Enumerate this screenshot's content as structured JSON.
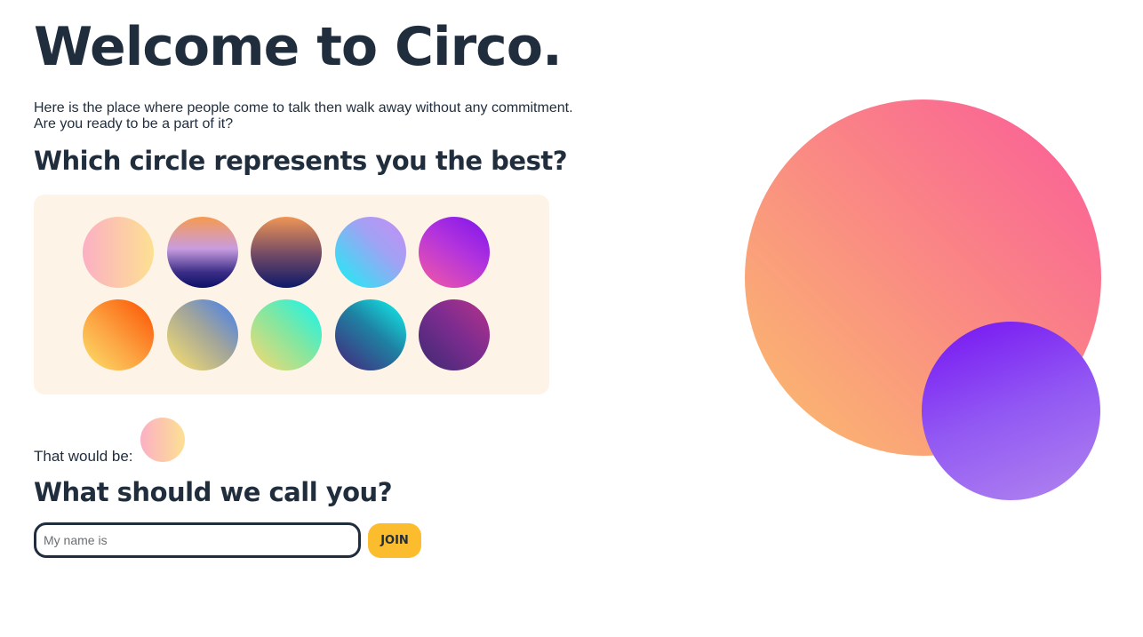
{
  "header": {
    "title": "Welcome to Circo."
  },
  "intro": {
    "line1": "Here is the place where people come to talk then walk away without any commitment.",
    "line2": "Are you ready to be a part of it?"
  },
  "picker": {
    "heading": "Which circle represents you the best?",
    "swatches": [
      {
        "name": "pink-yellow",
        "colors": [
          "#fbb0c4",
          "#fde092"
        ]
      },
      {
        "name": "sunset-navy",
        "colors": [
          "#f79a4f",
          "#c89de0",
          "#0c1266"
        ]
      },
      {
        "name": "orange-navy",
        "colors": [
          "#ef9554",
          "#6e4866",
          "#0d1a6a"
        ]
      },
      {
        "name": "lilac-cyan",
        "colors": [
          "#c98bf6",
          "#14f2f5"
        ]
      },
      {
        "name": "pink-violet",
        "colors": [
          "#f45aa3",
          "#7c14ec"
        ]
      },
      {
        "name": "yellow-orange",
        "colors": [
          "#fde16a",
          "#fb5000"
        ]
      },
      {
        "name": "yellow-blue",
        "colors": [
          "#fde26b",
          "#3e7df4"
        ]
      },
      {
        "name": "yellow-aqua",
        "colors": [
          "#fcd86d",
          "#11f6f2"
        ]
      },
      {
        "name": "purple-aqua",
        "colors": [
          "#46237a",
          "#11f6f2"
        ]
      },
      {
        "name": "indigo-magenta",
        "colors": [
          "#3c2a73",
          "#b5338b"
        ]
      }
    ],
    "selected": "pink-yellow"
  },
  "selection": {
    "label": "That would be:"
  },
  "name": {
    "heading": "What should we call you?",
    "placeholder": "My name is",
    "value": "",
    "join_label": "JOIN"
  },
  "colors": {
    "text": "#1f2d3d",
    "picker_bg": "#fdf4e7",
    "button": "#fbbc2e"
  }
}
